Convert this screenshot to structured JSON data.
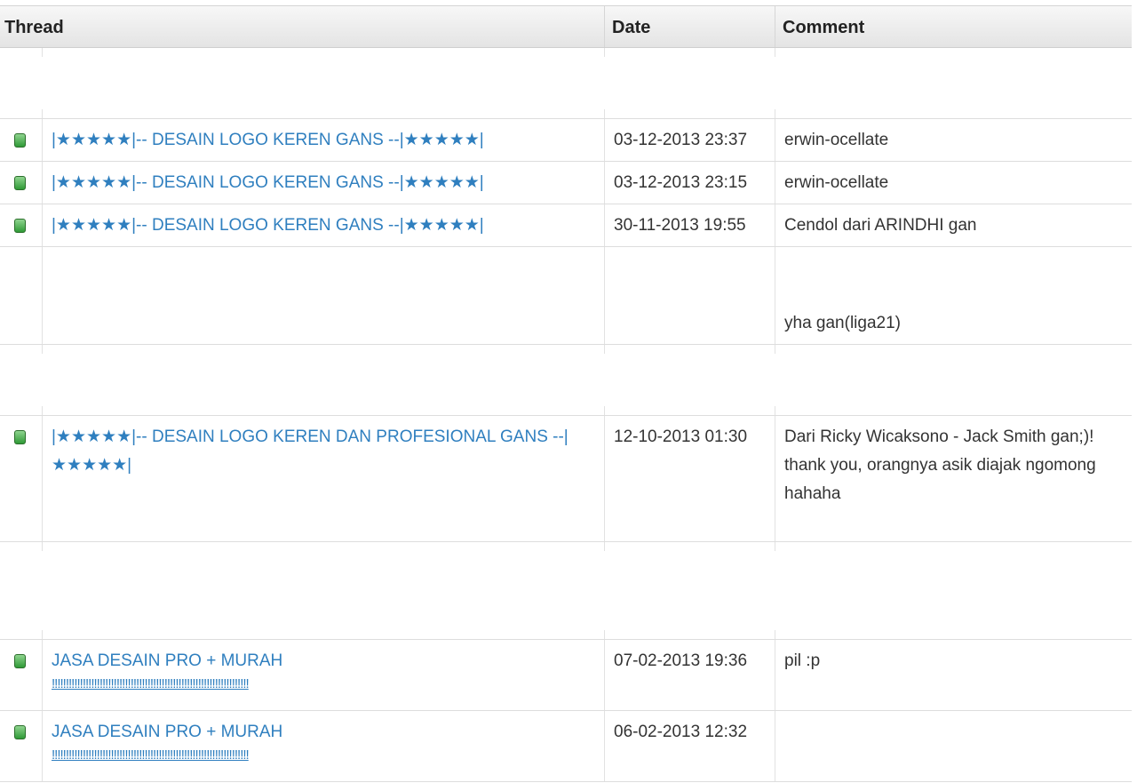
{
  "header": {
    "thread": "Thread",
    "date": "Date",
    "comment": "Comment"
  },
  "rows": [
    {
      "title": "|★★★★★|-- DESAIN LOGO KEREN GANS --|★★★★★|",
      "subtitle": "",
      "date": "03-12-2013 23:37",
      "comment": "erwin-ocellate"
    },
    {
      "title": "|★★★★★|-- DESAIN LOGO KEREN GANS --|★★★★★|",
      "subtitle": "",
      "date": "03-12-2013 23:15",
      "comment": "erwin-ocellate"
    },
    {
      "title": "|★★★★★|-- DESAIN LOGO KEREN GANS --|★★★★★|",
      "subtitle": "",
      "date": "30-11-2013 19:55",
      "comment": "Cendol dari ARINDHI gan"
    },
    {
      "title": "",
      "subtitle": "",
      "date": "",
      "comment": "yha gan(liga21)"
    },
    {
      "title": "|★★★★★|-- DESAIN LOGO KEREN DAN PROFESIONAL GANS --|★★★★★|",
      "subtitle": "",
      "date": "12-10-2013 01:30",
      "comment": "Dari Ricky Wicaksono - Jack Smith gan;)! thank you, orangnya asik diajak ngomong hahaha"
    },
    {
      "title": "JASA DESAIN PRO + MURAH",
      "subtitle": "!!!!!!!!!!!!!!!!!!!!!!!!!!!!!!!!!!!!!!!!!!!!!!!!!!!!!!!!!!!!!!!!!!!!!!",
      "date": "07-02-2013 19:36",
      "comment": "pil :p"
    },
    {
      "title": "JASA DESAIN PRO + MURAH",
      "subtitle": "!!!!!!!!!!!!!!!!!!!!!!!!!!!!!!!!!!!!!!!!!!!!!!!!!!!!!!!!!!!!!!!!!!!!!!",
      "date": "06-02-2013 12:32",
      "comment": ""
    }
  ]
}
